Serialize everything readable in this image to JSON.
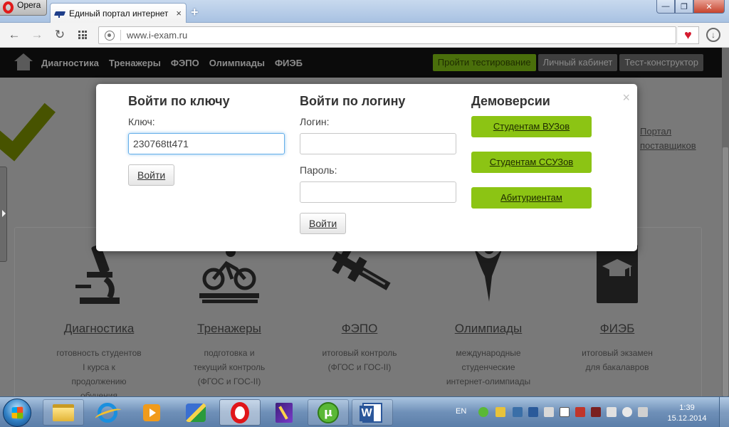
{
  "browser": {
    "menu_label": "Opera",
    "tab_title": "Единый портал интернет",
    "tab_close": "×",
    "new_tab": "+",
    "minimize": "—",
    "maximize": "❐",
    "close": "✕",
    "back_icon": "←",
    "forward_icon": "→",
    "reload_icon": "↻",
    "url": "www.i-exam.ru",
    "bookmark_icon": "♥",
    "download_icon": "↓"
  },
  "site_nav": {
    "links": [
      "Диагностика",
      "Тренажеры",
      "ФЭПО",
      "Олимпиады",
      "ФИЭБ"
    ],
    "take_test": "Пройти тестирование",
    "cabinet": "Личный кабинет",
    "builder": "Тест-конструктор"
  },
  "portal_link": {
    "line1": "Портал",
    "line2": "поставщиков"
  },
  "features": [
    {
      "title": "Диагностика",
      "desc": "готовность студентов I курса к продолжению обучения"
    },
    {
      "title": "Тренажеры",
      "desc": "подготовка и текущий контроль (ФГОС и ГОС-II)"
    },
    {
      "title": "ФЭПО",
      "desc": "итоговый контроль (ФГОС и ГОС-II)"
    },
    {
      "title": "Олимпиады",
      "desc": "международные студенческие интернет-олимпиады"
    },
    {
      "title": "ФИЭБ",
      "desc": "итоговый экзамен для бакалавров"
    }
  ],
  "modal": {
    "close": "×",
    "key_login": {
      "heading": "Войти по ключу",
      "key_label": "Ключ:",
      "key_value": "230768tt471",
      "submit": "Войти"
    },
    "user_login": {
      "heading": "Войти по логину",
      "login_label": "Логин:",
      "login_value": "",
      "password_label": "Пароль:",
      "password_value": "",
      "submit": "Войти"
    },
    "demo": {
      "heading": "Демоверсии",
      "buttons": [
        "Студентам ВУЗов",
        "Студентам ССУЗов",
        "Абитуриентам"
      ]
    }
  },
  "taskbar": {
    "lang": "EN",
    "time": "1:39",
    "date": "15.12.2014",
    "utorrent_glyph": "µ"
  },
  "colors": {
    "demo_green": "#8cc414",
    "focus_blue": "#66afe9",
    "heart_red": "#d51b2f"
  }
}
